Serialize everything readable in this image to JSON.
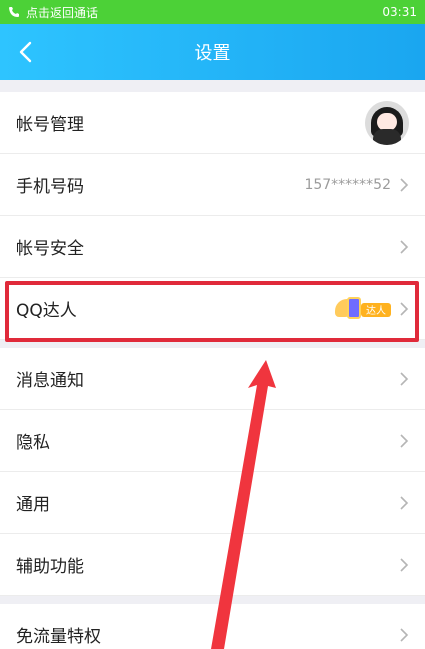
{
  "status_bar": {
    "call_text": "点击返回通话",
    "time": "03:31"
  },
  "header": {
    "title": "设置",
    "back_icon": "chevron-left-icon"
  },
  "rows": [
    {
      "label": "帐号管理"
    },
    {
      "label": "手机号码",
      "value": "157******52"
    },
    {
      "label": "帐号安全"
    },
    {
      "label": "QQ达人",
      "badge_text": "达人"
    },
    {
      "label": "消息通知"
    },
    {
      "label": "隐私"
    },
    {
      "label": "通用"
    },
    {
      "label": "辅助功能"
    },
    {
      "label": "免流量特权"
    }
  ],
  "colors": {
    "status_bar_bg": "#4cd137",
    "header_gradient": [
      "#2ec4ff",
      "#1aa6f0"
    ],
    "highlight": "#e02a3a",
    "arrow": "#f0353e"
  }
}
